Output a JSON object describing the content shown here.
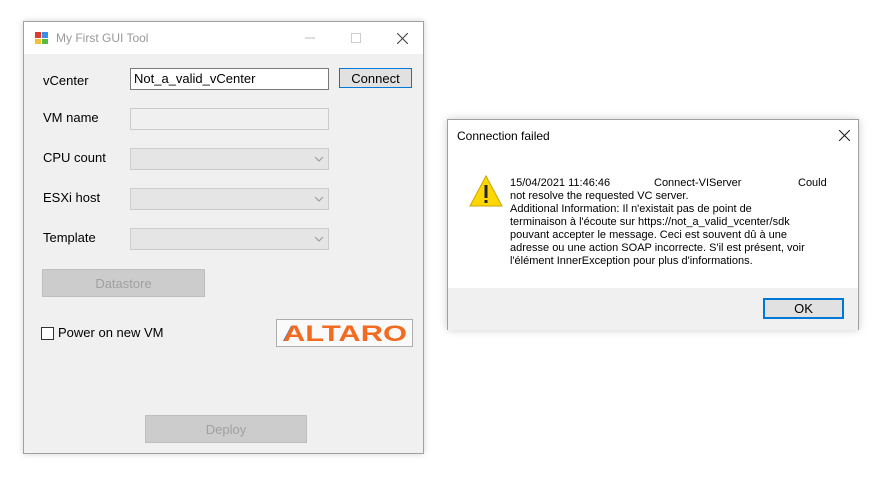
{
  "main_window": {
    "title": "My First GUI Tool",
    "vcenter_label": "vCenter",
    "vcenter_value": "Not_a_valid_vCenter",
    "connect_label": "Connect",
    "vm_name_label": "VM name",
    "vm_name_value": "",
    "cpu_label": "CPU count",
    "esxi_label": "ESXi host",
    "template_label": "Template",
    "datastore_label": "Datastore",
    "power_on_label": "Power on new VM",
    "power_on_checked": false,
    "logo_text": "ALTARO",
    "deploy_label": "Deploy"
  },
  "dialog": {
    "title": "Connection failed",
    "timestamp": "15/04/2021 11:46:46",
    "source": "Connect-VIServer",
    "could": "Could",
    "message_lines": [
      "not resolve the requested VC server.",
      "Additional Information: Il n'existait pas de point de",
      "terminaison à l'écoute sur https://not_a_valid_vcenter/sdk",
      "pouvant accepter le message. Ceci est souvent dû à une",
      "adresse ou une action SOAP incorrecte. S'il est présent, voir",
      "l'élément InnerException pour plus d'informations."
    ],
    "ok_label": "OK"
  },
  "colors": {
    "accent": "#0078d7",
    "logo_orange": "#f26b21",
    "warning_yellow": "#ffd700"
  },
  "icons": [
    "app-icon",
    "minimize-icon",
    "maximize-icon",
    "close-icon",
    "chevron-down-icon",
    "warning-icon",
    "altaro-logo"
  ]
}
